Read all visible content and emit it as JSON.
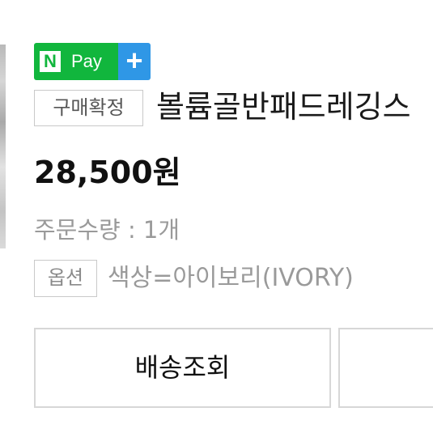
{
  "badges": {
    "npay_n": "N",
    "npay_pay": "Pay",
    "npay_plus": "+"
  },
  "order": {
    "status_tag": "구매확정",
    "product_title": "볼륨골반패드레깅스",
    "price": "28,500원",
    "quantity": "주문수량 : 1개",
    "option_tag": "옵션",
    "option_value": "색상=아이보리(IVORY)"
  },
  "actions": {
    "track_shipping": "배송조회",
    "second": ""
  },
  "colors": {
    "npay_green": "#11b63d",
    "npay_blue": "#2f97e6",
    "tag_border": "#c9c9c9",
    "button_border": "#d7d7d7",
    "muted_text": "#9a9a9a"
  }
}
